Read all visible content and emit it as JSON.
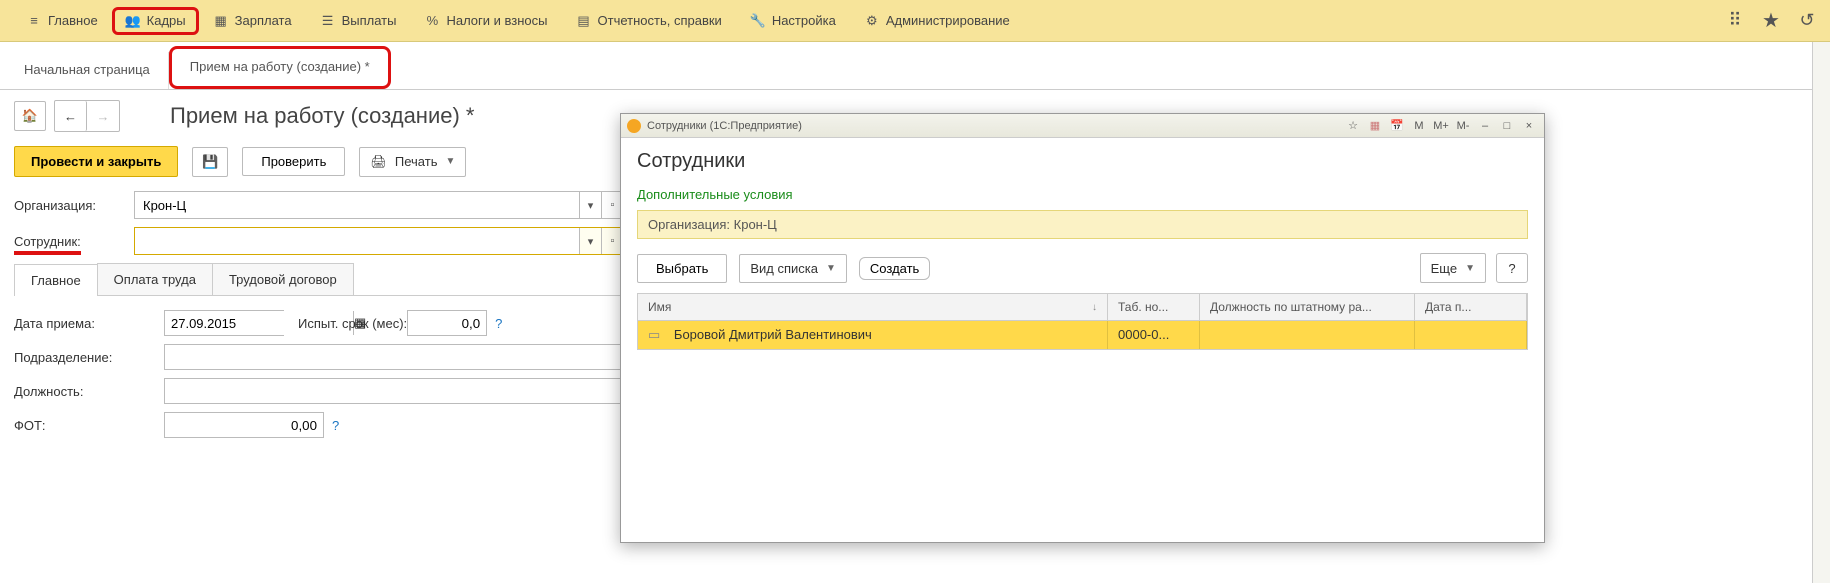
{
  "topmenu": {
    "items": [
      {
        "label": "Главное"
      },
      {
        "label": "Кадры"
      },
      {
        "label": "Зарплата"
      },
      {
        "label": "Выплаты"
      },
      {
        "label": "Налоги и взносы"
      },
      {
        "label": "Отчетность, справки"
      },
      {
        "label": "Настройка"
      },
      {
        "label": "Администрирование"
      }
    ]
  },
  "tabs": {
    "home": "Начальная страница",
    "active": "Прием на работу (создание) *"
  },
  "page": {
    "title": "Прием на работу (создание) *"
  },
  "actions": {
    "post_close": "Провести и закрыть",
    "check": "Проверить",
    "print": "Печать"
  },
  "form": {
    "org_label": "Организация:",
    "org_value": "Крон-Ц",
    "emp_label": "Сотрудник:",
    "emp_value": ""
  },
  "intabs": {
    "t1": "Главное",
    "t2": "Оплата труда",
    "t3": "Трудовой договор"
  },
  "inner": {
    "date_label": "Дата приема:",
    "date_value": "27.09.2015",
    "probation_label": "Испыт. срок (мес):",
    "probation_value": "0,0",
    "dept_label": "Подразделение:",
    "pos_label": "Должность:",
    "fot_label": "ФОТ:",
    "fot_value": "0,00",
    "q": "?"
  },
  "modal": {
    "titlebar": "Сотрудники  (1С:Предприятие)",
    "tb_icons": {
      "m": "M",
      "mp": "M+",
      "mm": "M-",
      "min": "–",
      "max": "□",
      "close": "×"
    },
    "title": "Сотрудники",
    "extra": "Дополнительные условия",
    "org_label": "Организация: ",
    "org_value": "Крон-Ц",
    "btn_select": "Выбрать",
    "btn_view": "Вид списка",
    "btn_create": "Создать",
    "btn_more": "Еще",
    "q": "?",
    "cols": {
      "name": "Имя",
      "tab": "Таб. но...",
      "pos": "Должность по штатному ра...",
      "date": "Дата п..."
    },
    "rows": [
      {
        "name": "Боровой Дмитрий Валентинович",
        "tab": "0000-0...",
        "pos": "",
        "date": ""
      }
    ]
  }
}
